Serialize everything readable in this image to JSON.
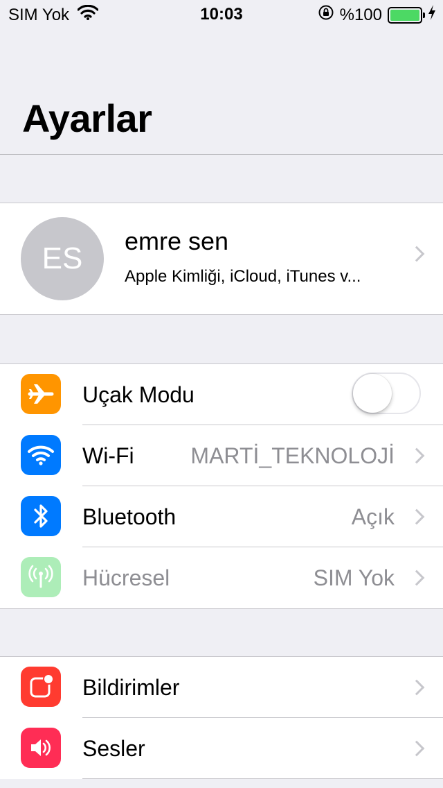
{
  "status_bar": {
    "carrier": "SIM Yok",
    "time": "10:03",
    "battery_text": "%100",
    "battery_level": 1.0
  },
  "header": {
    "title": "Ayarlar"
  },
  "profile": {
    "initials": "ES",
    "name": "emre sen",
    "subtitle": "Apple Kimliği, iCloud, iTunes v..."
  },
  "connectivity": [
    {
      "label": "Uçak Modu",
      "icon": "airplane-icon",
      "color": "#ff9500",
      "toggle_on": false
    },
    {
      "label": "Wi-Fi",
      "value": "MARTİ_TEKNOLOJİ",
      "icon": "wifi-icon",
      "color": "#007aff"
    },
    {
      "label": "Bluetooth",
      "value": "Açık",
      "icon": "bluetooth-icon",
      "color": "#007aff"
    },
    {
      "label": "Hücresel",
      "value": "SIM Yok",
      "icon": "cellular-antenna-icon",
      "color": "#4cd964",
      "disabled": true
    }
  ],
  "general": [
    {
      "label": "Bildirimler",
      "icon": "notifications-icon",
      "color": "#ff3b30"
    },
    {
      "label": "Sesler",
      "icon": "speaker-icon",
      "color": "#ff2d55"
    }
  ]
}
